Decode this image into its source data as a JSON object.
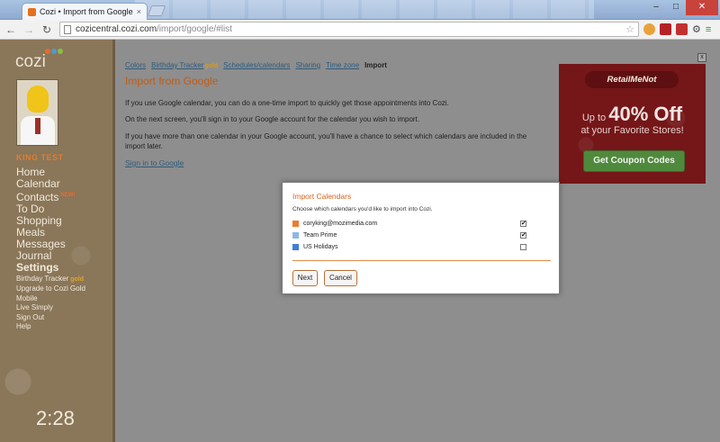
{
  "browser": {
    "tab_title": "Cozi • Import from Google",
    "tab_close": "×",
    "url_host": "cozicentral.cozi.com",
    "url_path": "/import/google/#list",
    "controls": {
      "minimize": "–",
      "maximize": "□",
      "close": "✕"
    }
  },
  "sidebar": {
    "logo": "cozi",
    "user_name": "KING TEST",
    "nav_main": [
      {
        "label": "Home"
      },
      {
        "label": "Calendar"
      },
      {
        "label": "Contacts",
        "badge": "NEW!"
      },
      {
        "label": "To Do"
      },
      {
        "label": "Shopping"
      },
      {
        "label": "Meals"
      },
      {
        "label": "Messages"
      },
      {
        "label": "Journal"
      },
      {
        "label": "Settings"
      }
    ],
    "nav_sub": [
      {
        "label": "Birthday Tracker",
        "badge": "gold"
      },
      {
        "label": "Upgrade to Cozi Gold"
      },
      {
        "label": "Mobile"
      },
      {
        "label": "Live Simply"
      },
      {
        "label": "Sign Out"
      },
      {
        "label": "Help"
      }
    ],
    "clock": "2:28"
  },
  "main": {
    "breadcrumbs": [
      {
        "label": "Colors"
      },
      {
        "label": "Birthday Tracker",
        "badge": "gold"
      },
      {
        "label": "Schedules/calendars"
      },
      {
        "label": "Sharing"
      },
      {
        "label": "Time zone"
      }
    ],
    "breadcrumb_current": "Import",
    "title": "Import from Google",
    "paragraphs": [
      "If you use Google calendar, you can do a one-time import to quickly get those appointments into Cozi.",
      "On the next screen, you'll sign in to your Google account for the calendar you wish to import.",
      "If you have more than one calendar in your Google account, you'll have a chance to select which calendars are included in the import later."
    ],
    "signin_link": "Sign in to Google"
  },
  "ad": {
    "close": "x",
    "logo": "RetailMeNot",
    "headline_pre": "Up to ",
    "headline_big": "40% Off",
    "sub": "at your Favorite Stores!",
    "button": "Get Coupon Codes"
  },
  "modal": {
    "title": "Import Calendars",
    "subtitle": "Choose which calendars you'd like to import into Cozi.",
    "calendars": [
      {
        "name": "coryking@mozimedia.com",
        "color": "#f07a30",
        "checked": true
      },
      {
        "name": "Team Prime",
        "color": "#8fb7e6",
        "checked": true
      },
      {
        "name": "US Holidays",
        "color": "#3f7fd6",
        "checked": false
      }
    ],
    "next_label": "Next",
    "cancel_label": "Cancel"
  }
}
